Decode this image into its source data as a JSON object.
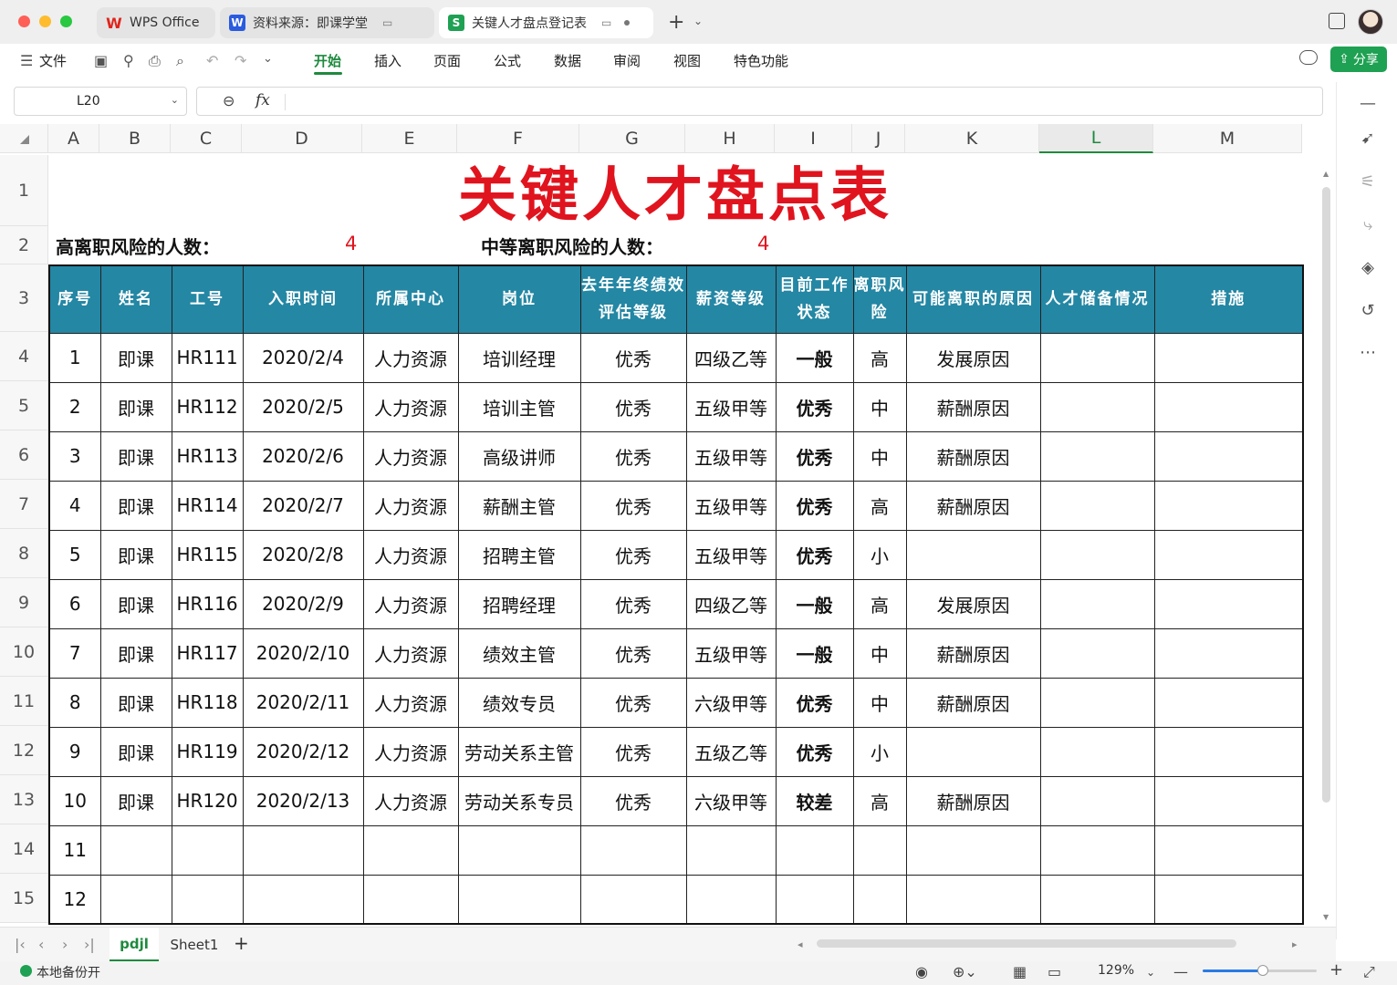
{
  "titlebar": {
    "tabs": [
      {
        "logo": "W",
        "label": "WPS Office",
        "logo_color": "#e0251b"
      },
      {
        "logo": "W",
        "label": "资料来源：即课学堂",
        "logo_color": "#2b5bde"
      },
      {
        "logo": "S",
        "label": "关键人才盘点登记表",
        "logo_color": "#1ea152"
      }
    ]
  },
  "ribbon": {
    "file_label": "文件",
    "menus": [
      "开始",
      "插入",
      "页面",
      "公式",
      "数据",
      "审阅",
      "视图",
      "特色功能"
    ],
    "share_label": "分享"
  },
  "formula_bar": {
    "cell_ref": "L20",
    "fx": "fx"
  },
  "columns": [
    "A",
    "B",
    "C",
    "D",
    "E",
    "F",
    "G",
    "H",
    "I",
    "J",
    "K",
    "L",
    "M"
  ],
  "selected_column": "L",
  "rows": [
    "1",
    "2",
    "3",
    "4",
    "5",
    "6",
    "7",
    "8",
    "9",
    "10",
    "11",
    "12",
    "13",
    "14",
    "15"
  ],
  "sheet": {
    "title": "关键人才盘点表",
    "high_risk_label": "高离职风险的人数：",
    "high_risk_value": "4",
    "medium_risk_label": "中等离职风险的人数：",
    "medium_risk_value": "4",
    "headers": [
      "序号",
      "姓名",
      "工号",
      "入职时间",
      "所属中心",
      "岗位",
      "去年年终绩效评估等级",
      "薪资等级",
      "目前工作状态",
      "离职风险",
      "可能离职的原因",
      "人才储备情况",
      "措施"
    ],
    "records": [
      [
        "1",
        "即课",
        "HR111",
        "2020/2/4",
        "人力资源",
        "培训经理",
        "优秀",
        "四级乙等",
        "一般",
        "高",
        "发展原因",
        "",
        ""
      ],
      [
        "2",
        "即课",
        "HR112",
        "2020/2/5",
        "人力资源",
        "培训主管",
        "优秀",
        "五级甲等",
        "优秀",
        "中",
        "薪酬原因",
        "",
        ""
      ],
      [
        "3",
        "即课",
        "HR113",
        "2020/2/6",
        "人力资源",
        "高级讲师",
        "优秀",
        "五级甲等",
        "优秀",
        "中",
        "薪酬原因",
        "",
        ""
      ],
      [
        "4",
        "即课",
        "HR114",
        "2020/2/7",
        "人力资源",
        "薪酬主管",
        "优秀",
        "五级甲等",
        "优秀",
        "高",
        "薪酬原因",
        "",
        ""
      ],
      [
        "5",
        "即课",
        "HR115",
        "2020/2/8",
        "人力资源",
        "招聘主管",
        "优秀",
        "五级甲等",
        "优秀",
        "小",
        "",
        "",
        ""
      ],
      [
        "6",
        "即课",
        "HR116",
        "2020/2/9",
        "人力资源",
        "招聘经理",
        "优秀",
        "四级乙等",
        "一般",
        "高",
        "发展原因",
        "",
        ""
      ],
      [
        "7",
        "即课",
        "HR117",
        "2020/2/10",
        "人力资源",
        "绩效主管",
        "优秀",
        "五级甲等",
        "一般",
        "中",
        "薪酬原因",
        "",
        ""
      ],
      [
        "8",
        "即课",
        "HR118",
        "2020/2/11",
        "人力资源",
        "绩效专员",
        "优秀",
        "六级甲等",
        "优秀",
        "中",
        "薪酬原因",
        "",
        ""
      ],
      [
        "9",
        "即课",
        "HR119",
        "2020/2/12",
        "人力资源",
        "劳动关系主管",
        "优秀",
        "五级乙等",
        "优秀",
        "小",
        "",
        "",
        ""
      ],
      [
        "10",
        "即课",
        "HR120",
        "2020/2/13",
        "人力资源",
        "劳动关系专员",
        "优秀",
        "六级甲等",
        "较差",
        "高",
        "薪酬原因",
        "",
        ""
      ],
      [
        "11",
        "",
        "",
        "",
        "",
        "",
        "",
        "",
        "",
        "",
        "",
        "",
        ""
      ],
      [
        "12",
        "",
        "",
        "",
        "",
        "",
        "",
        "",
        "",
        "",
        "",
        "",
        ""
      ]
    ]
  },
  "sheet_tabs": [
    "pdjl",
    "Sheet1"
  ],
  "active_sheet": "pdjl",
  "status": {
    "backup_label": "本地备份开",
    "zoom": "129%",
    "zoom_fraction": 0.53
  },
  "colors": {
    "accent_green": "#1e8a3e",
    "title_red": "#e0141e",
    "header_teal": "#2487a4"
  }
}
